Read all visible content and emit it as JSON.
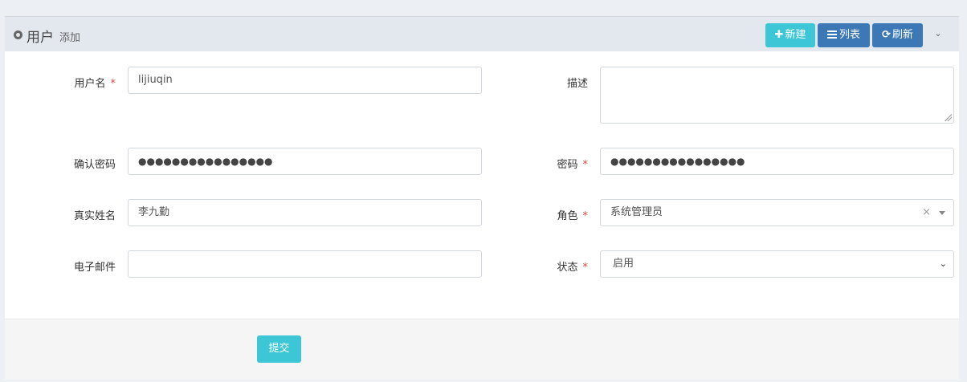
{
  "header": {
    "title": "用户",
    "subtitle": "添加",
    "buttons": {
      "new": "新建",
      "list": "列表",
      "refresh": "刷新"
    }
  },
  "form": {
    "username": {
      "label": "用户名",
      "value": "lijiuqin"
    },
    "description": {
      "label": "描述",
      "value": ""
    },
    "confirm_password": {
      "label": "确认密码",
      "value": "●●●●●●●●●●●●●●●●"
    },
    "password": {
      "label": "密码",
      "value": "●●●●●●●●●●●●●●●●"
    },
    "real_name": {
      "label": "真实姓名",
      "value": "李九勤"
    },
    "role": {
      "label": "角色",
      "value": "系统管理员"
    },
    "email": {
      "label": "电子邮件",
      "value": ""
    },
    "status": {
      "label": "状态",
      "value": "启用"
    },
    "required_mark": "*"
  },
  "footer": {
    "submit": "提交"
  },
  "colors": {
    "accent": "#3dc6d5",
    "primary": "#3c78b5",
    "required": "#dd4b39"
  }
}
